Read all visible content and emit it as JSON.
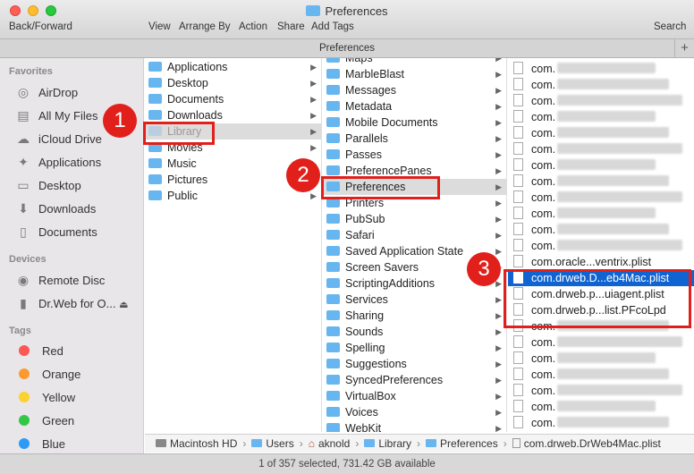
{
  "window": {
    "title": "Preferences"
  },
  "toolbar": {
    "back_forward": "Back/Forward",
    "view": "View",
    "arrange_by": "Arrange By",
    "action": "Action",
    "share": "Share",
    "add_tags": "Add Tags",
    "search": "Search"
  },
  "tab": {
    "label": "Preferences",
    "plus": "+"
  },
  "sidebar": {
    "favorites_header": "Favorites",
    "favorites": [
      "AirDrop",
      "All My Files",
      "iCloud Drive",
      "Applications",
      "Desktop",
      "Downloads",
      "Documents"
    ],
    "devices_header": "Devices",
    "devices": [
      "Remote Disc",
      "Dr.Web for O..."
    ],
    "tags_header": "Tags",
    "tags": [
      {
        "label": "Red",
        "color": "#fc5753"
      },
      {
        "label": "Orange",
        "color": "#fd9a2f"
      },
      {
        "label": "Yellow",
        "color": "#fdd12e"
      },
      {
        "label": "Green",
        "color": "#33c748"
      },
      {
        "label": "Blue",
        "color": "#2c9bf7"
      }
    ]
  },
  "column1": [
    "Applications",
    "Desktop",
    "Documents",
    "Downloads",
    "Library",
    "Movies",
    "Music",
    "Pictures",
    "Public"
  ],
  "column2": [
    "Maps",
    "MarbleBlast",
    "Messages",
    "Metadata",
    "Mobile Documents",
    "Parallels",
    "Passes",
    "PreferencePanes",
    "Preferences",
    "Printers",
    "PubSub",
    "Safari",
    "Saved Application State",
    "Screen Savers",
    "ScriptingAdditions",
    "Services",
    "Sharing",
    "Sounds",
    "Spelling",
    "Suggestions",
    "SyncedPreferences",
    "VirtualBox",
    "Voices",
    "WebKit"
  ],
  "column3": [
    "com.",
    "com.",
    "com.",
    "com.",
    "com.",
    "com.",
    "com.",
    "com.",
    "com.",
    "com.",
    "com.",
    "com.",
    "com.oracle...ventrix.plist",
    "com.drweb.D...eb4Mac.plist",
    "com.drweb.p...uiagent.plist",
    "com.drweb.p...list.PFcoLpd",
    "com.",
    "com.",
    "com.",
    "com.",
    "com.",
    "com.",
    "com."
  ],
  "pathbar": [
    "Macintosh HD",
    "Users",
    "aknold",
    "Library",
    "Preferences",
    "com.drweb.DrWeb4Mac.plist"
  ],
  "status": "1 of 357 selected, 731.42 GB available",
  "annotations": [
    "1",
    "2",
    "3"
  ],
  "colors": {
    "annotation": "#e1201b",
    "selection": "#0f64d2",
    "folder": "#67b6ef"
  }
}
